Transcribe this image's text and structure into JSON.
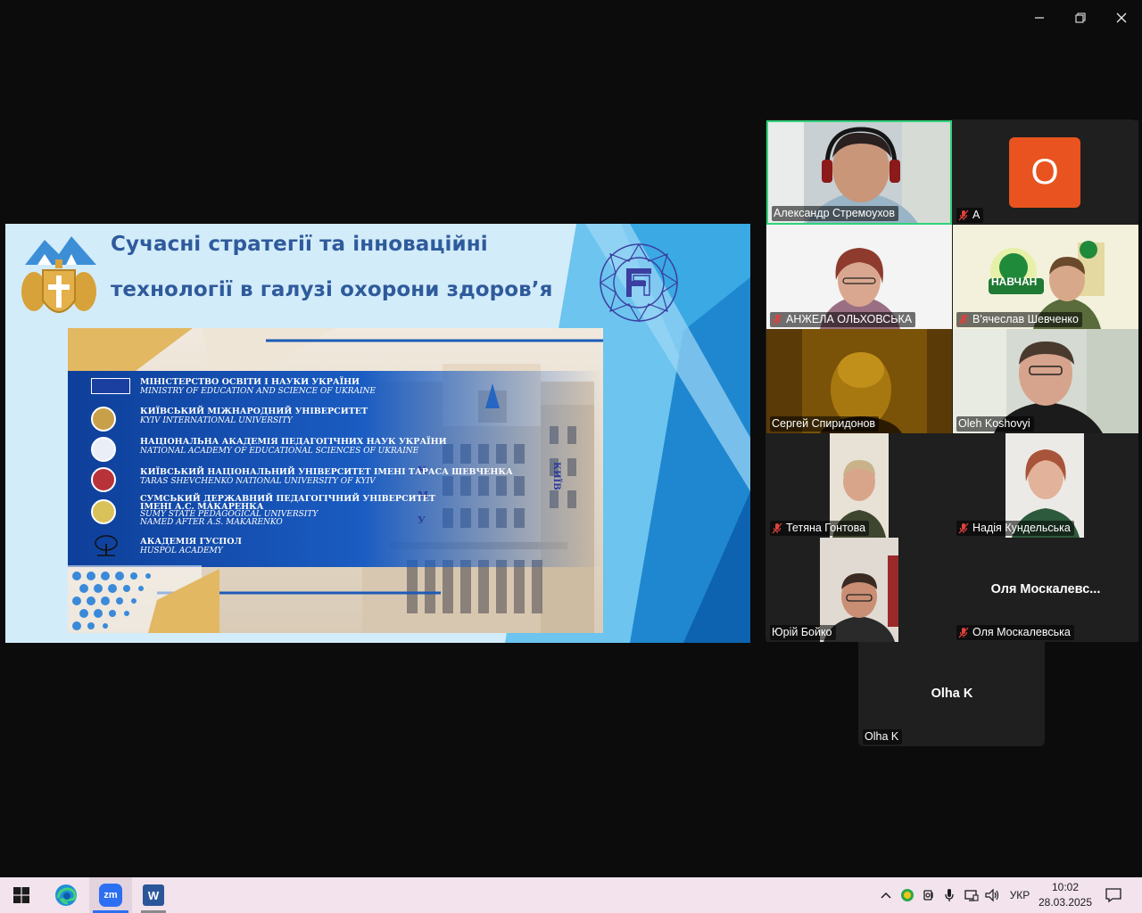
{
  "window": {
    "minimize_icon": "minimize-icon",
    "restore_icon": "restore-icon",
    "close_icon": "close-icon"
  },
  "slide": {
    "title_line1": "Сучасні стратегії та інноваційні",
    "title_line2": "технології в галузі охорони здоров’я",
    "organizations": [
      {
        "uk": "МІНІСТЕРСТВО ОСВІТИ І НАУКИ УКРАЇНИ",
        "en": "MINISTRY OF EDUCATION AND SCIENCE OF UKRAINE"
      },
      {
        "uk": "КИЇВСЬКИЙ МІЖНАРОДНИЙ УНІВЕРСИТЕТ",
        "en": "KYIV INTERNATIONAL UNIVERSITY"
      },
      {
        "uk": "НАЦІОНАЛЬНА АКАДЕМІЯ ПЕДАГОГІЧНИХ НАУК УКРАЇНИ",
        "en": "NATIONAL ACADEMY OF EDUCATIONAL SCIENCES OF UKRAINE"
      },
      {
        "uk": "КИЇВСЬКИЙ НАЦІОНАЛЬНИЙ УНІВЕРСИТЕТ ІМЕНІ ТАРАСА ШЕВЧЕНКА",
        "en": "TARAS SHEVCHENKO NATIONAL UNIVERSITY OF KYIV"
      },
      {
        "uk": "СУМСЬКИЙ ДЕРЖАВНИЙ ПЕДАГОГІЧНИЙ УНІВЕРСИТЕТ",
        "uk2": "ІМЕНІ А.С. МАКАРЕНКА",
        "en": "SUMY STATE PEDAGOGICAL UNIVERSITY",
        "en2": "NAMED AFTER A.S. MAKARENKO"
      },
      {
        "uk": "АКАДЕМІЯ ГУСПОЛ",
        "en": "HUSPOL ACADEMY"
      }
    ],
    "building_letters": [
      "К",
      "М",
      "У"
    ],
    "building_sign": "КИЇВ"
  },
  "participants": [
    {
      "name": "Александр Стремоухов",
      "muted": false,
      "active_speaker": true
    },
    {
      "name": "А",
      "muted": true,
      "avatar_letter": "O",
      "avatar_color": "#e8531f"
    },
    {
      "name": "АНЖЕЛА ОЛЬХОВСЬКА",
      "muted": true
    },
    {
      "name": "В'ячеслав Шевченко",
      "muted": true,
      "background_text": "НАВЧАН"
    },
    {
      "name": "Сергей Спиридонов",
      "muted": false
    },
    {
      "name": "Oleh Koshovyi",
      "muted": false
    },
    {
      "name": "Тетяна Гонтова",
      "muted": true
    },
    {
      "name": "Надія Кундельська",
      "muted": true
    },
    {
      "name": "Юрій Бойко",
      "muted": false
    },
    {
      "name": "Оля Москалевська",
      "muted": true,
      "display_name": "Оля  Москалевс..."
    },
    {
      "name": "Olha K",
      "muted": false,
      "display_name": "Olha K"
    }
  ],
  "colors": {
    "active_speaker_border": "#2fd27a",
    "muted_icon": "#e0413a",
    "slide_title": "#2f5b9c"
  },
  "taskbar": {
    "start_icon": "windows-start-icon",
    "apps": [
      {
        "name": "Microsoft Edge",
        "icon": "edge-icon"
      },
      {
        "name": "Zoom",
        "icon": "zoom-icon",
        "label": "zm"
      },
      {
        "name": "Microsoft Word",
        "icon": "word-icon",
        "label": "W"
      }
    ],
    "language": "УКР",
    "time": "10:02",
    "date": "28.03.2025"
  }
}
